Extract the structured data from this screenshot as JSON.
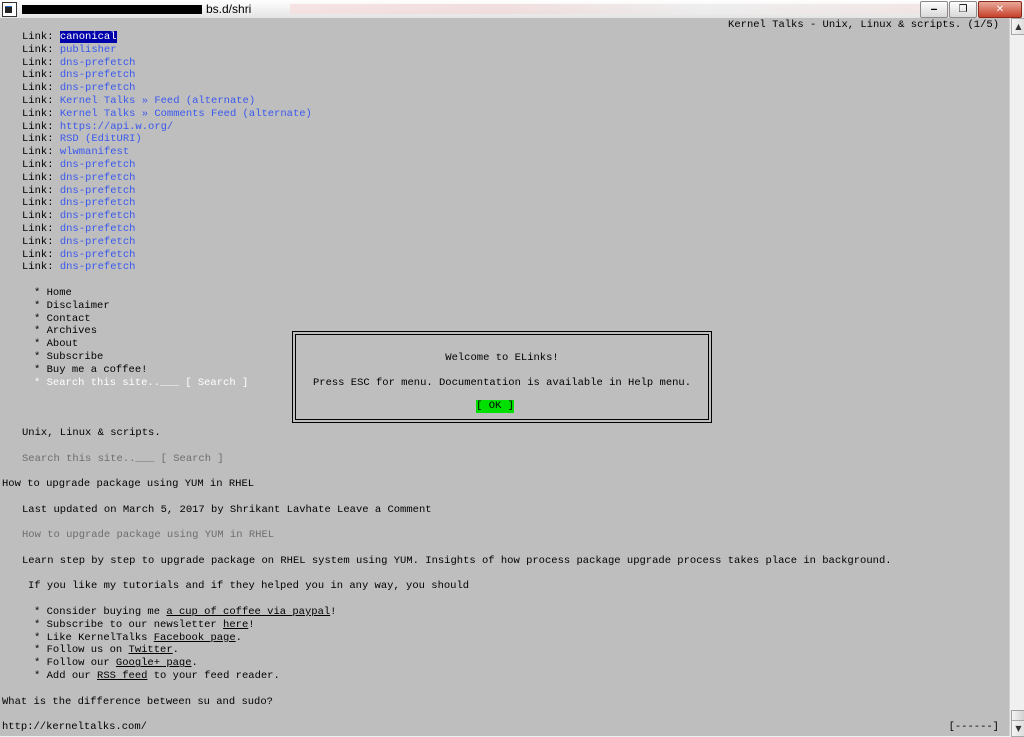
{
  "window": {
    "title_visible": "bs.d/shri",
    "minimize_glyph": "‒",
    "restore_glyph": "❐",
    "close_glyph": "✕",
    "icon": "terminal-icon"
  },
  "page_header": "Kernel Talks - Unix, Linux & scripts. (1/5)",
  "links": [
    {
      "prefix": "Link: ",
      "text": "canonical",
      "selected": true
    },
    {
      "prefix": "Link: ",
      "text": "publisher"
    },
    {
      "prefix": "Link: ",
      "text": "dns-prefetch"
    },
    {
      "prefix": "Link: ",
      "text": "dns-prefetch"
    },
    {
      "prefix": "Link: ",
      "text": "dns-prefetch"
    },
    {
      "prefix": "Link: ",
      "text": "Kernel Talks » Feed (alternate)"
    },
    {
      "prefix": "Link: ",
      "text": "Kernel Talks » Comments Feed (alternate)"
    },
    {
      "prefix": "Link: ",
      "text": "https://api.w.org/"
    },
    {
      "prefix": "Link: ",
      "text": "RSD (EditURI)"
    },
    {
      "prefix": "Link: ",
      "text": "wlwmanifest"
    },
    {
      "prefix": "Link: ",
      "text": "dns-prefetch"
    },
    {
      "prefix": "Link: ",
      "text": "dns-prefetch"
    },
    {
      "prefix": "Link: ",
      "text": "dns-prefetch"
    },
    {
      "prefix": "Link: ",
      "text": "dns-prefetch"
    },
    {
      "prefix": "Link: ",
      "text": "dns-prefetch"
    },
    {
      "prefix": "Link: ",
      "text": "dns-prefetch"
    },
    {
      "prefix": "Link: ",
      "text": "dns-prefetch"
    },
    {
      "prefix": "Link: ",
      "text": "dns-prefetch"
    },
    {
      "prefix": "Link: ",
      "text": "dns-prefetch"
    }
  ],
  "nav": {
    "bullet": "* ",
    "items": [
      "Home",
      "Disclaimer",
      "Contact",
      "Archives",
      "About",
      "Subscribe",
      "Buy me a coffee!"
    ],
    "search_line": "Search this site..___ [ Search ]"
  },
  "dialog": {
    "title": "Welcome to ELinks!",
    "message": "Press ESC for menu. Documentation is available in Help menu.",
    "ok_label": "[ OK ]"
  },
  "content": {
    "tagline": "Unix, Linux & scripts.",
    "search_line": "Search this site..___ [ Search ]",
    "post_title": "How to upgrade package using YUM in RHEL",
    "meta": "Last updated on March 5, 2017 by Shrikant Lavhate Leave a Comment",
    "image_alt": "How to upgrade package using YUM in RHEL",
    "intro": "Learn step by step to upgrade package on RHEL system using YUM. Insights of how process package upgrade process takes place in background.",
    "tutorial_line": "If you like my tutorials and if they helped you in any way, you should",
    "bullet": "* ",
    "bullets": [
      {
        "before": "Consider buying me ",
        "link": "a cup of coffee via paypal",
        "after": "!"
      },
      {
        "before": "Subscribe to our newsletter ",
        "link": "here",
        "after": "!"
      },
      {
        "before": "Like KernelTalks ",
        "link": "Facebook page",
        "after": "."
      },
      {
        "before": "Follow us on ",
        "link": "Twitter",
        "after": "."
      },
      {
        "before": "Follow our ",
        "link": "Google+ page",
        "after": "."
      },
      {
        "before": "Add our ",
        "link": "RSS feed",
        "after": " to your feed reader."
      }
    ],
    "next_heading": "What is the difference between su and sudo?"
  },
  "status": {
    "url": "http://kerneltalks.com/",
    "progress": "[------]"
  },
  "scrollbar": {
    "up_glyph": "▲",
    "down_glyph": "▼"
  }
}
